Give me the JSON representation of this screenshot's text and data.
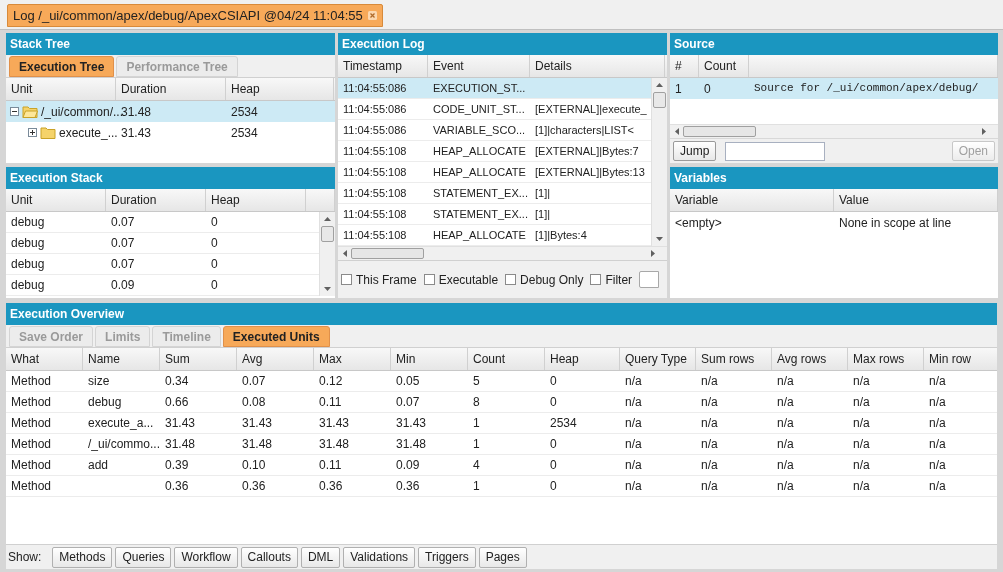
{
  "document_tab": {
    "title": "Log /_ui/common/apex/debug/ApexCSIAPI @04/24 11:04:55",
    "selected": true
  },
  "stack_tree": {
    "title": "Stack Tree",
    "tabs": [
      {
        "label": "Execution Tree",
        "selected": true
      },
      {
        "label": "Performance Tree",
        "selected": false
      }
    ],
    "columns": [
      "Unit",
      "Duration",
      "Heap"
    ],
    "rows": [
      {
        "unit": "/_ui/common/...",
        "duration": "31.48",
        "heap": "2534",
        "expanded": true,
        "selected": true,
        "children": [
          {
            "unit": "execute_...",
            "duration": "31.43",
            "heap": "2534",
            "expanded": false,
            "selected": false
          }
        ]
      }
    ]
  },
  "execution_stack": {
    "title": "Execution Stack",
    "columns": [
      "Unit",
      "Duration",
      "Heap"
    ],
    "rows": [
      {
        "unit": "debug",
        "duration": "0.07",
        "heap": "0"
      },
      {
        "unit": "debug",
        "duration": "0.07",
        "heap": "0"
      },
      {
        "unit": "debug",
        "duration": "0.07",
        "heap": "0"
      },
      {
        "unit": "debug",
        "duration": "0.09",
        "heap": "0"
      }
    ]
  },
  "execution_log": {
    "title": "Execution Log",
    "columns": [
      "Timestamp",
      "Event",
      "Details"
    ],
    "rows": [
      {
        "timestamp": "11:04:55:086",
        "event": "EXECUTION_ST...",
        "details": "",
        "selected": true
      },
      {
        "timestamp": "11:04:55:086",
        "event": "CODE_UNIT_ST...",
        "details": "[EXTERNAL]|execute_",
        "selected": false
      },
      {
        "timestamp": "11:04:55:086",
        "event": "VARIABLE_SCO...",
        "details": "[1]|characters|LIST<",
        "selected": false
      },
      {
        "timestamp": "11:04:55:108",
        "event": "HEAP_ALLOCATE",
        "details": "[EXTERNAL]|Bytes:7",
        "selected": false
      },
      {
        "timestamp": "11:04:55:108",
        "event": "HEAP_ALLOCATE",
        "details": "[EXTERNAL]|Bytes:13",
        "selected": false
      },
      {
        "timestamp": "11:04:55:108",
        "event": "STATEMENT_EX...",
        "details": "[1]|",
        "selected": false
      },
      {
        "timestamp": "11:04:55:108",
        "event": "STATEMENT_EX...",
        "details": "[1]|",
        "selected": false
      },
      {
        "timestamp": "11:04:55:108",
        "event": "HEAP_ALLOCATE",
        "details": "[1]|Bytes:4",
        "selected": false
      }
    ],
    "filters": [
      {
        "label": "This Frame",
        "checked": false
      },
      {
        "label": "Executable",
        "checked": false
      },
      {
        "label": "Debug Only",
        "checked": false
      },
      {
        "label": "Filter",
        "checked": false
      }
    ]
  },
  "source": {
    "title": "Source",
    "columns": [
      "#",
      "Count"
    ],
    "rows": [
      {
        "line": "1",
        "count": "0",
        "text": "Source for /_ui/common/apex/debug/",
        "selected": true
      }
    ],
    "jump_button": {
      "label": "Jump",
      "disabled": false
    },
    "open_button": {
      "label": "Open",
      "disabled": true
    }
  },
  "variables": {
    "title": "Variables",
    "columns": [
      "Variable",
      "Value"
    ],
    "rows": [
      {
        "variable": "<empty>",
        "value": "None in scope at line"
      }
    ]
  },
  "execution_overview": {
    "title": "Execution Overview",
    "tabs": [
      {
        "label": "Save Order",
        "selected": false
      },
      {
        "label": "Limits",
        "selected": false
      },
      {
        "label": "Timeline",
        "selected": false
      },
      {
        "label": "Executed Units",
        "selected": true
      }
    ],
    "columns": [
      "What",
      "Name",
      "Sum",
      "Avg",
      "Max",
      "Min",
      "Count",
      "Heap",
      "Query Type",
      "Sum rows",
      "Avg rows",
      "Max rows",
      "Min row"
    ],
    "rows": [
      [
        "Method",
        "size",
        "0.34",
        "0.07",
        "0.12",
        "0.05",
        "5",
        "0",
        "n/a",
        "n/a",
        "n/a",
        "n/a",
        "n/a"
      ],
      [
        "Method",
        "debug",
        "0.66",
        "0.08",
        "0.11",
        "0.07",
        "8",
        "0",
        "n/a",
        "n/a",
        "n/a",
        "n/a",
        "n/a"
      ],
      [
        "Method",
        "execute_a...",
        "31.43",
        "31.43",
        "31.43",
        "31.43",
        "1",
        "2534",
        "n/a",
        "n/a",
        "n/a",
        "n/a",
        "n/a"
      ],
      [
        "Method",
        "/_ui/commo...",
        "31.48",
        "31.48",
        "31.48",
        "31.48",
        "1",
        "0",
        "n/a",
        "n/a",
        "n/a",
        "n/a",
        "n/a"
      ],
      [
        "Method",
        "add",
        "0.39",
        "0.10",
        "0.11",
        "0.09",
        "4",
        "0",
        "n/a",
        "n/a",
        "n/a",
        "n/a",
        "n/a"
      ],
      [
        "Method",
        "",
        "0.36",
        "0.36",
        "0.36",
        "0.36",
        "1",
        "0",
        "n/a",
        "n/a",
        "n/a",
        "n/a",
        "n/a"
      ]
    ],
    "show_label": "Show:",
    "show_buttons": [
      "Methods",
      "Queries",
      "Workflow",
      "Callouts",
      "DML",
      "Validations",
      "Triggers",
      "Pages"
    ]
  }
}
